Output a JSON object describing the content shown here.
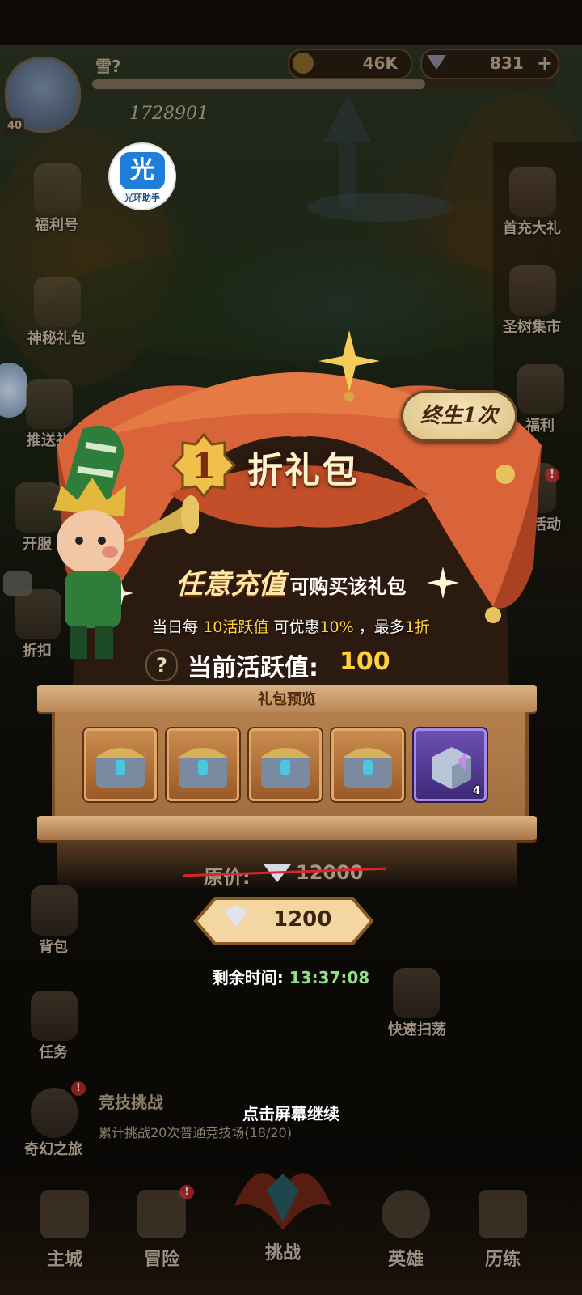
{
  "player": {
    "name": "雪?",
    "level": "40",
    "power": "1728901",
    "gold": "46K",
    "diamonds": "831",
    "assistant_badge_char": "光",
    "assistant_badge_label": "光环助手"
  },
  "left_menu": [
    {
      "label": "福利号",
      "icon": "gift-bag-icon"
    },
    {
      "label": "神秘礼包",
      "icon": "mystery-gift-icon"
    },
    {
      "label": "推送礼",
      "icon": "push-gift-icon"
    },
    {
      "label": "开服",
      "icon": "server-open-icon"
    },
    {
      "label": "折扣",
      "icon": "discount-icon"
    },
    {
      "label": "背包",
      "icon": "backpack-icon"
    },
    {
      "label": "任务",
      "icon": "quest-icon"
    },
    {
      "label": "奇幻之旅",
      "icon": "fantasy-journey-icon"
    }
  ],
  "right_menu": [
    {
      "label": "首充大礼",
      "icon": "first-recharge-icon"
    },
    {
      "label": "圣树集市",
      "icon": "sacred-tree-market-icon"
    },
    {
      "label": "福利",
      "icon": "welfare-icon"
    },
    {
      "label": "节日活动",
      "icon": "festival-icon"
    },
    {
      "label": "快速扫荡",
      "icon": "quick-sweep-icon"
    }
  ],
  "background_text": {
    "arena_title": "竞技挑战",
    "arena_desc": "累计挑战20次普通竞技场(18/20)"
  },
  "bottom_nav": [
    {
      "label": "主城"
    },
    {
      "label": "冒险"
    },
    {
      "label": "挑战"
    },
    {
      "label": "英雄"
    },
    {
      "label": "历练"
    }
  ],
  "popup": {
    "title_number": "1",
    "title_text": "折礼包",
    "lifetime_badge": "终生1次",
    "recharge_main": "任意充值",
    "recharge_sub": "可购买该礼包",
    "discount_prefix": "当日每",
    "discount_highlight1": "10活跃值",
    "discount_mid": "可优惠",
    "discount_highlight2": "10%",
    "discount_sep": "，最多",
    "discount_highlight3": "1折",
    "activity_label": "当前活跃值:",
    "activity_value": "100",
    "preview_title": "礼包预览",
    "items": [
      {
        "icon": "golden-chest-icon",
        "count": ""
      },
      {
        "icon": "golden-chest-icon",
        "count": ""
      },
      {
        "icon": "golden-chest-icon",
        "count": ""
      },
      {
        "icon": "golden-chest-icon",
        "count": ""
      },
      {
        "icon": "crystal-cube-icon",
        "count": "4"
      }
    ],
    "original_price_label": "原价:",
    "original_price_value": "12000",
    "price_value": "1200",
    "timer_label": "剩余时间:",
    "timer_value": "13:37:08",
    "tap_continue": "点击屏幕继续"
  },
  "colors": {
    "gold_highlight": "#ffd13b",
    "timer_green": "#8ee08a",
    "strike_red": "#d62828",
    "curtain_orange": "#d9643a"
  }
}
